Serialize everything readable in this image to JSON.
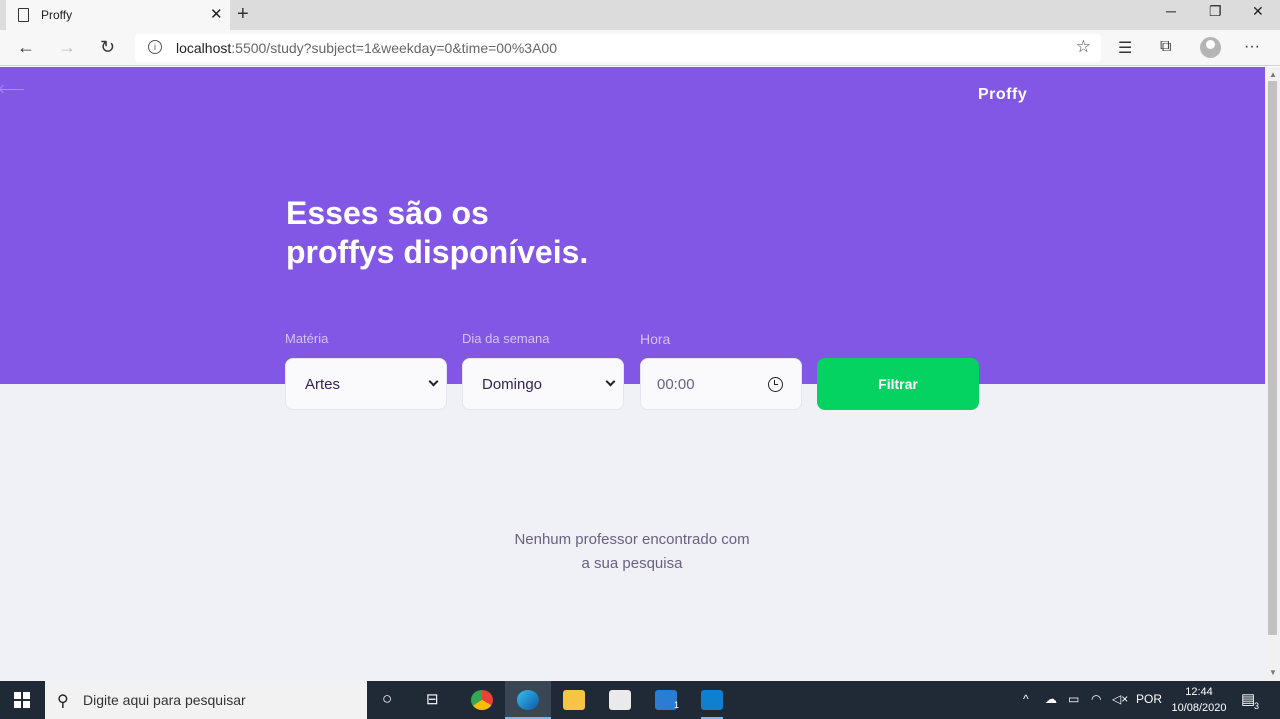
{
  "browser": {
    "tab_title": "Proffy",
    "tab_close": "✕",
    "new_tab": "+",
    "url_host": "localhost",
    "url_rest": ":5500/study?subject=1&weekday=0&time=00%3A00",
    "win_min": "─",
    "win_max": "❐",
    "win_close": "✕"
  },
  "page": {
    "logo": "Proffy",
    "headline_line1": "Esses são os",
    "headline_line2": "proffys disponíveis.",
    "filters": {
      "subject_label": "Matéria",
      "subject_value": "Artes",
      "weekday_label": "Dia da semana",
      "weekday_value": "Domingo",
      "time_label": "Hora",
      "time_value": "00:00",
      "submit_label": "Filtrar"
    },
    "empty_line1": "Nenhum professor encontrado com",
    "empty_line2": "a sua pesquisa"
  },
  "taskbar": {
    "search_placeholder": "Digite aqui para pesquisar",
    "mail_badge": "1",
    "language": "POR",
    "time": "12:44",
    "date": "10/08/2020",
    "notifications": "3"
  },
  "colors": {
    "primary": "#8257e5",
    "secondary": "#04d361",
    "background": "#f0f0f7"
  }
}
